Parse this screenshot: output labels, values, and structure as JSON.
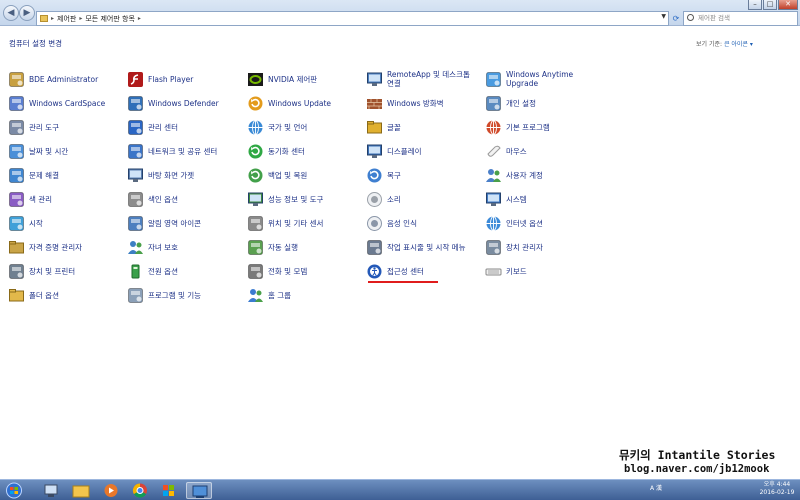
{
  "address": {
    "crumb1": "제어판",
    "crumb2": "모든 제어판 항목"
  },
  "search": {
    "placeholder": "제어판 검색"
  },
  "header": {
    "title": "컴퓨터 설정 변경",
    "view_by": "보기 기준:",
    "view_value": "큰 아이콘 ▾"
  },
  "items": [
    {
      "label": "BDE Administrator",
      "icon": "bde-admin-icon"
    },
    {
      "label": "Windows CardSpace",
      "icon": "cardspace-icon"
    },
    {
      "label": "관리 도구",
      "icon": "admin-tools-icon"
    },
    {
      "label": "날짜 및 시간",
      "icon": "date-time-icon"
    },
    {
      "label": "문제 해결",
      "icon": "troubleshoot-icon"
    },
    {
      "label": "색 관리",
      "icon": "color-management-icon"
    },
    {
      "label": "시작",
      "icon": "getting-started-icon"
    },
    {
      "label": "자격 증명 관리자",
      "icon": "credential-manager-icon"
    },
    {
      "label": "장치 및 프린터",
      "icon": "devices-printers-icon"
    },
    {
      "label": "폴더 옵션",
      "icon": "folder-options-icon"
    },
    {
      "label": "Flash Player",
      "icon": "flash-player-icon"
    },
    {
      "label": "Windows Defender",
      "icon": "windows-defender-icon"
    },
    {
      "label": "관리 센터",
      "icon": "action-center-icon"
    },
    {
      "label": "네트워크 및 공유 센터",
      "icon": "network-sharing-icon"
    },
    {
      "label": "바탕 화면 가젯",
      "icon": "desktop-gadgets-icon"
    },
    {
      "label": "색인 옵션",
      "icon": "indexing-options-icon"
    },
    {
      "label": "알림 영역 아이콘",
      "icon": "notification-icons-icon"
    },
    {
      "label": "자녀 보호",
      "icon": "parental-controls-icon"
    },
    {
      "label": "전원 옵션",
      "icon": "power-options-icon"
    },
    {
      "label": "프로그램 및 기능",
      "icon": "programs-features-icon"
    },
    {
      "label": "NVIDIA 제어판",
      "icon": "nvidia-icon"
    },
    {
      "label": "Windows Update",
      "icon": "windows-update-icon"
    },
    {
      "label": "국가 및 언어",
      "icon": "region-language-icon"
    },
    {
      "label": "동기화 센터",
      "icon": "sync-center-icon"
    },
    {
      "label": "백업 및 복원",
      "icon": "backup-restore-icon"
    },
    {
      "label": "성능 정보 및 도구",
      "icon": "performance-icon"
    },
    {
      "label": "위치 및 기타 센서",
      "icon": "location-sensors-icon"
    },
    {
      "label": "자동 실행",
      "icon": "autoplay-icon"
    },
    {
      "label": "전화 및 모뎀",
      "icon": "phone-modem-icon"
    },
    {
      "label": "홈 그룹",
      "icon": "homegroup-icon"
    },
    {
      "label": "RemoteApp 및 데스크톱 연결",
      "icon": "remoteapp-icon"
    },
    {
      "label": "Windows 방화벽",
      "icon": "windows-firewall-icon"
    },
    {
      "label": "글꼴",
      "icon": "fonts-icon"
    },
    {
      "label": "디스플레이",
      "icon": "display-icon"
    },
    {
      "label": "복구",
      "icon": "recovery-icon"
    },
    {
      "label": "소리",
      "icon": "sound-icon"
    },
    {
      "label": "음성 인식",
      "icon": "speech-recognition-icon"
    },
    {
      "label": "작업 표시줄 및 시작 메뉴",
      "icon": "taskbar-start-icon"
    },
    {
      "label": "접근성 센터",
      "icon": "ease-of-access-icon"
    },
    {
      "label": "Windows Anytime Upgrade",
      "icon": "anytime-upgrade-icon"
    },
    {
      "label": "개인 설정",
      "icon": "personalization-icon"
    },
    {
      "label": "기본 프로그램",
      "icon": "default-programs-icon"
    },
    {
      "label": "마우스",
      "icon": "mouse-icon"
    },
    {
      "label": "사용자 계정",
      "icon": "user-accounts-icon"
    },
    {
      "label": "시스템",
      "icon": "system-icon"
    },
    {
      "label": "인터넷 옵션",
      "icon": "internet-options-icon"
    },
    {
      "label": "장치 관리자",
      "icon": "device-manager-icon"
    },
    {
      "label": "키보드",
      "icon": "keyboard-icon"
    }
  ],
  "watermark": {
    "line1": "뮤키의 Intantile Stories",
    "line2": "blog.naver.com/jb12mook"
  },
  "taskbar": {
    "clock_time": "오후 4:44",
    "clock_date": "2016-02-19",
    "tray_text": "A 漢"
  }
}
